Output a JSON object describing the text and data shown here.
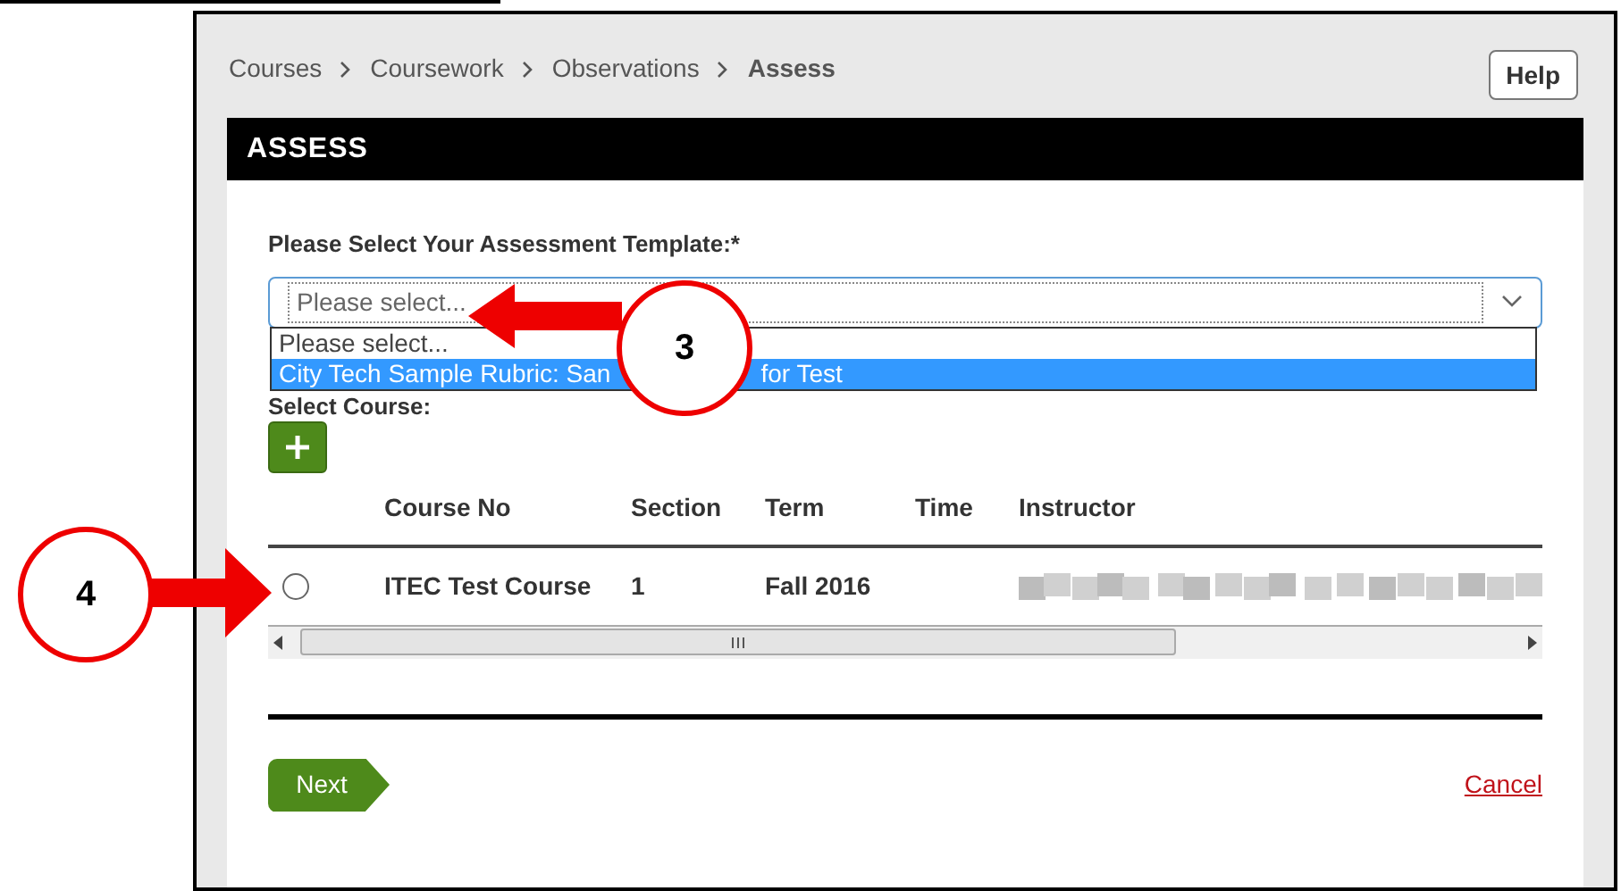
{
  "breadcrumb": [
    {
      "label": "Courses",
      "current": false
    },
    {
      "label": "Coursework",
      "current": false
    },
    {
      "label": "Observations",
      "current": false
    },
    {
      "label": "Assess",
      "current": true
    }
  ],
  "help_button": "Help",
  "header": "ASSESS",
  "template_field": {
    "label": "Please Select Your Assessment Template:*",
    "placeholder": "Please select...",
    "expanded": true,
    "options": [
      {
        "selected": false,
        "kind": "placeholder",
        "label": "Please select..."
      },
      {
        "label_start": "City Tech Sample Rubric: San",
        "label_end": "for Test",
        "selected": true,
        "kind": "item"
      }
    ]
  },
  "course_label": "Select Course:",
  "table": {
    "columns": [
      "Course No",
      "Section",
      "Term",
      "Time",
      "Instructor"
    ],
    "rows": [
      {
        "selected": false,
        "course_no": "ITEC Test Course",
        "section": "1",
        "term": "Fall 2016",
        "time": ""
      }
    ]
  },
  "next_button": "Next",
  "cancel_link": "Cancel",
  "callouts": [
    {
      "label": "3"
    },
    {
      "label": "4"
    }
  ]
}
